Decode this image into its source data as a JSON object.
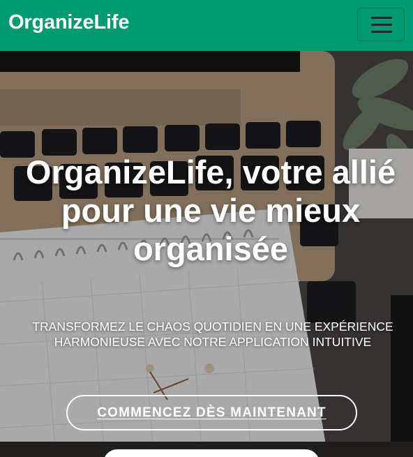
{
  "navbar": {
    "brand": "OrganizeLife",
    "toggle_icon": "hamburger-menu-icon",
    "background_color": "#009970"
  },
  "hero": {
    "background_image": "desk-with-laptop-calendar-and-plant-photo",
    "title": "OrganizeLife, votre allié pour une vie mieux organisée",
    "subtitle": "TRANSFORMEZ LE CHAOS QUOTIDIEN EN UNE EXPÉRIENCE HARMONIEUSE AVEC NOTRE APPLICATION INTUITIVE",
    "cta_label": "COMMENCEZ DÈS MAINTENANT"
  }
}
